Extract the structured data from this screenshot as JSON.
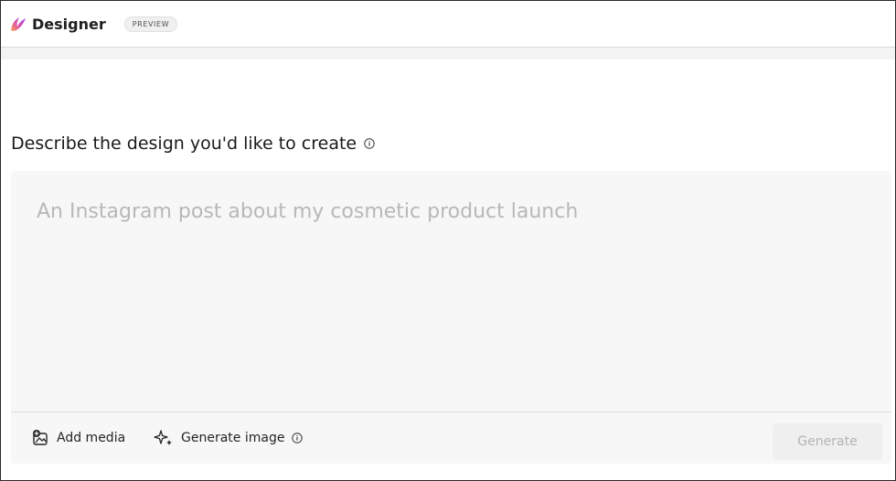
{
  "app": {
    "title": "Designer",
    "badge": "PREVIEW",
    "logo_icon": "designer-logo-icon",
    "accent_color": "#9b5cf5"
  },
  "main": {
    "heading": "Describe the design you'd like to create",
    "heading_icon": "info-icon",
    "prompt": {
      "value": "",
      "placeholder": "An Instagram post about my cosmetic product launch"
    },
    "toolbar": {
      "add_media_label": "Add media",
      "add_media_icon": "add-image-icon",
      "generate_image_label": "Generate image",
      "generate_image_icon": "sparkle-icon",
      "generate_image_info_icon": "info-icon",
      "generate_button_label": "Generate"
    }
  }
}
